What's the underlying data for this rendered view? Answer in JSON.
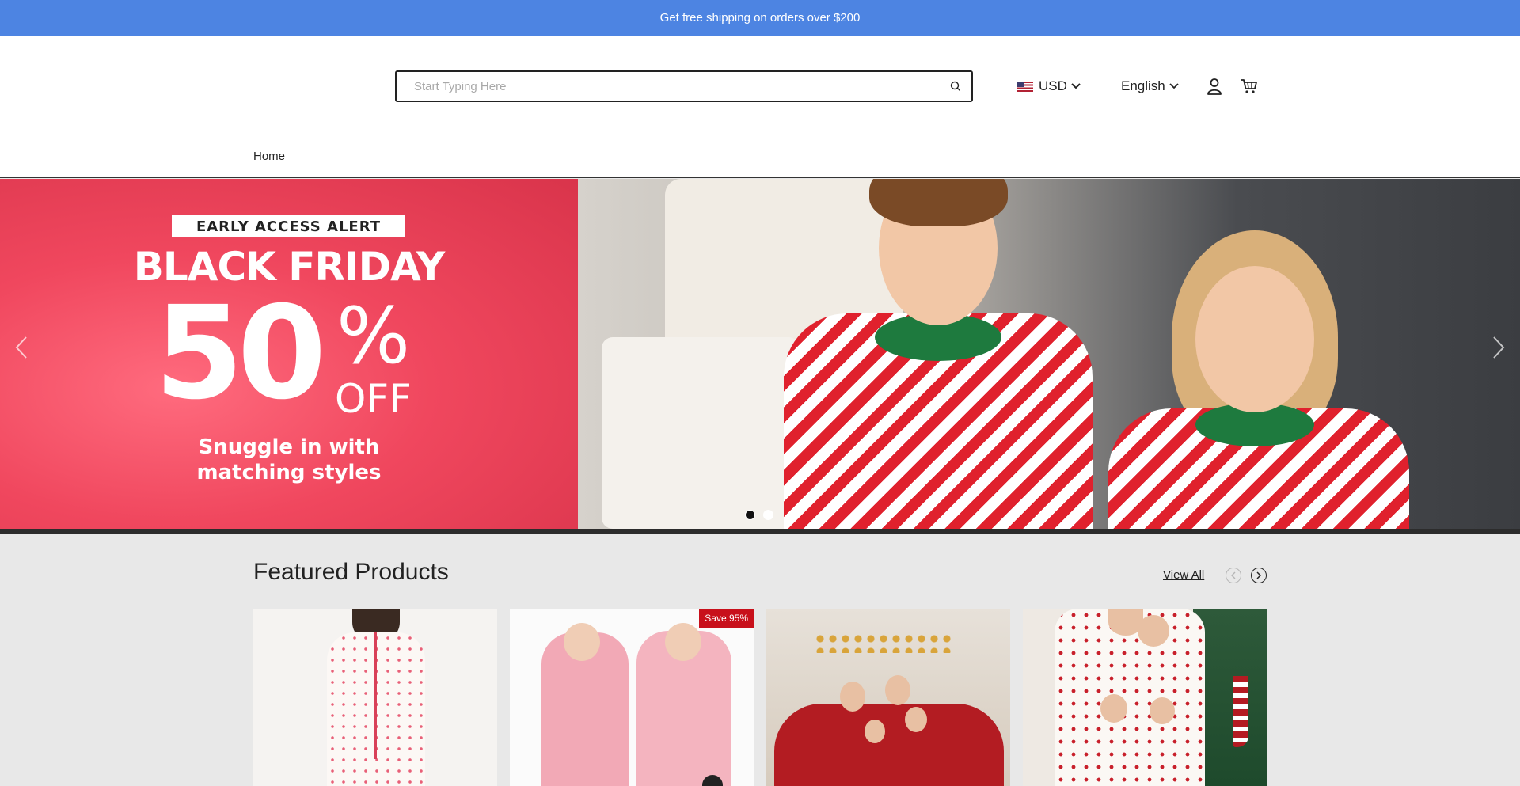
{
  "announcement": "Get free shipping on orders over $200",
  "search": {
    "placeholder": "Start Typing Here"
  },
  "currency": {
    "code": "USD"
  },
  "language": {
    "label": "English"
  },
  "nav": {
    "items": [
      "Home"
    ]
  },
  "hero": {
    "alert": "EARLY ACCESS ALERT",
    "headline": "BLACK FRIDAY",
    "discount": "50",
    "percent": "%",
    "off": "OFF",
    "tagline_line1": "Snuggle in with",
    "tagline_line2": "matching styles",
    "slides": 2,
    "active_slide": 1
  },
  "featured": {
    "title": "Featured Products",
    "view_all": "View All",
    "products": [
      {
        "badge": ""
      },
      {
        "badge": "Save 95%"
      },
      {
        "badge": ""
      },
      {
        "badge": ""
      }
    ]
  },
  "colors": {
    "announcement_bg": "#4d84e2",
    "hero_red": "#f0475e",
    "badge_red": "#c8101b"
  }
}
